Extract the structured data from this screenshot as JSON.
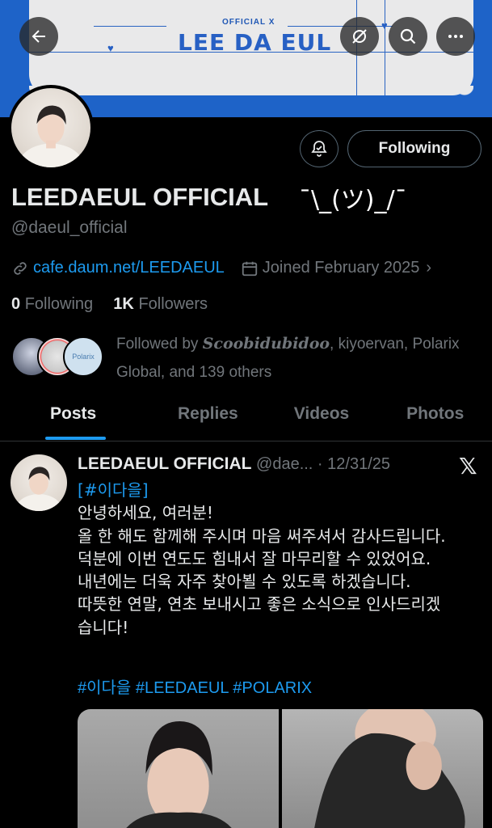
{
  "banner": {
    "small_text": "OFFICIAL X",
    "title": "LEE DA EUL"
  },
  "nav": {
    "back": "back-arrow",
    "hide": "eye-off",
    "search": "search",
    "more": "more"
  },
  "profile": {
    "display_name": "LEEDAEUL OFFICIAL",
    "shrug": "¯\\_(ツ)_/¯",
    "handle": "@daeul_official",
    "link": "cafe.daum.net/LEEDAEUL",
    "joined": "Joined February 2025",
    "following_count": "0",
    "following_label": "Following",
    "followers_count": "1K",
    "followers_label": "Followers",
    "follow_button": "Following",
    "followed_by_prefix": "Followed by ",
    "followed_by_name1": "Scoobidubidoo",
    "followed_by_rest": ", kiyoervan, Polarix Global, and 139 others",
    "followed_avatar3_text": "Polarix"
  },
  "tabs": [
    "Posts",
    "Replies",
    "Videos",
    "Photos"
  ],
  "post": {
    "author": "LEEDAEUL OFFICIAL",
    "handle": "@dae...",
    "date": "· 12/31/25",
    "tag_open": "[",
    "tag": "#이다을",
    "tag_close": "]",
    "lines": [
      "안녕하세요, 여러분!",
      "올 한 해도 함께해 주시며 마음 써주셔서 감사드립니다.",
      "덕분에 이번 연도도 힘내서 잘 마무리할 수 있었어요.",
      "내년에는 더욱 자주 찾아뵐 수 있도록 하겠습니다.",
      "따뜻한 연말, 연초 보내시고 좋은 소식으로 인사드리겠",
      "습니다!"
    ],
    "hashtags": "#이다을 #LEEDAEUL #POLARIX",
    "x_logo": "𝕏"
  },
  "colors": {
    "accent": "#1d9bf0",
    "banner_blue": "#1e63c8",
    "muted": "#71767b"
  }
}
